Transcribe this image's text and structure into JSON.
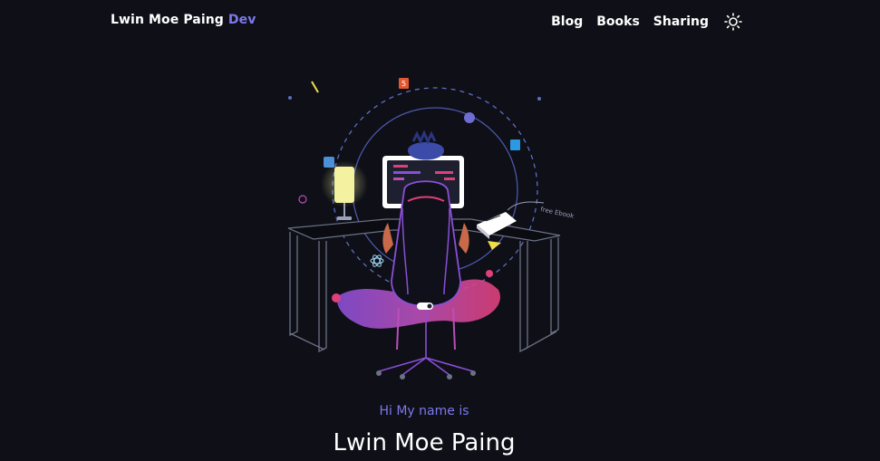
{
  "header": {
    "brand_name": "Lwin Moe Paing",
    "brand_accent": "Dev",
    "nav": [
      {
        "label": "Blog"
      },
      {
        "label": "Books"
      },
      {
        "label": "Sharing"
      }
    ],
    "theme_toggle_icon": "sun-icon"
  },
  "hero": {
    "illustration_icon": "developer-at-desk-illustration",
    "greeting": "Hi My name is",
    "name": "Lwin Moe Paing",
    "free_ebook_label": "free Ebook"
  },
  "colors": {
    "background": "#0e0f17",
    "accent": "#7c79ee",
    "text": "#ffffff",
    "pink": "#e0407a",
    "purple": "#8a4fd6",
    "lamp_glow": "#f4f1a1"
  }
}
